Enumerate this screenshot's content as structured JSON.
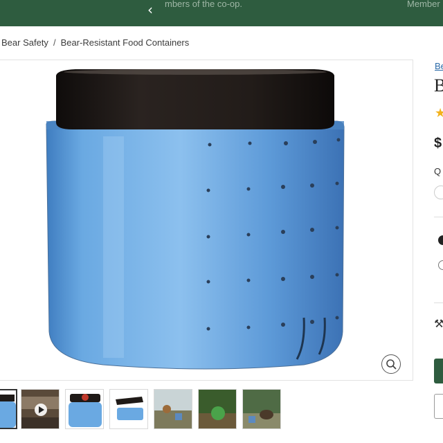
{
  "banner": {
    "message_left": "mbers of the co-op.",
    "message_right": "Member",
    "prev_icon": "chevron-left-icon"
  },
  "breadcrumb": {
    "items": [
      "Bear Safety",
      "Bear-Resistant Food Containers"
    ],
    "separator": "/"
  },
  "gallery": {
    "zoom_icon": "magnifier-icon",
    "thumbnails": [
      {
        "name": "thumb-jar-front"
      },
      {
        "name": "thumb-video",
        "icon": "play-icon"
      },
      {
        "name": "thumb-jar-lid-logo"
      },
      {
        "name": "thumb-jar-open"
      },
      {
        "name": "thumb-campsite"
      },
      {
        "name": "thumb-forest-container"
      },
      {
        "name": "thumb-bear"
      }
    ]
  },
  "side": {
    "brand_link": "Be",
    "title": "B",
    "star": "★",
    "price": "$",
    "quantity_label": "Q",
    "icon": "tools-icon"
  },
  "colors": {
    "banner": "#2e5c3f",
    "jar_blue": "#5f9fd8",
    "lid": "#1f1a17",
    "link": "#2b6aa8",
    "star": "#f3b21d"
  }
}
